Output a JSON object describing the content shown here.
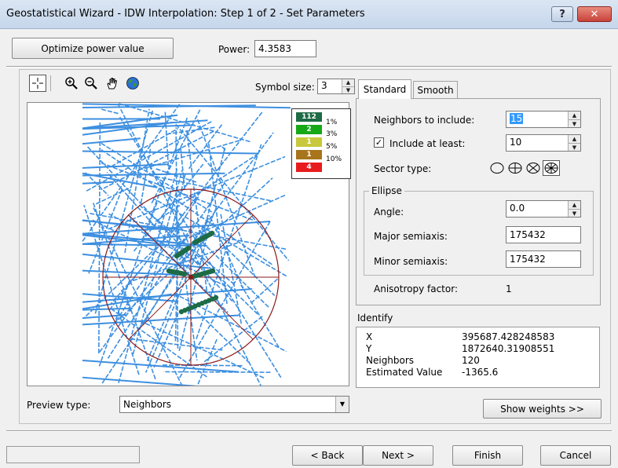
{
  "window": {
    "title": "Geostatistical Wizard - IDW Interpolation: Step 1 of 2 - Set Parameters",
    "help_label": "?",
    "close_label": "✕"
  },
  "top": {
    "optimize_label": "Optimize power value",
    "power_label": "Power:",
    "power_value": "4.3583"
  },
  "toolbar": {
    "symbol_size_label": "Symbol size:",
    "symbol_size_value": "3"
  },
  "tabs": [
    {
      "label": "Standard"
    },
    {
      "label": "Smooth"
    }
  ],
  "legend": {
    "rows": [
      {
        "count": "112",
        "color": "#1e6b46"
      },
      {
        "count": "2",
        "color": "#17a817"
      },
      {
        "count": "1",
        "color": "#c8c83c"
      },
      {
        "count": "1",
        "color": "#a8741c"
      },
      {
        "count": "4",
        "color": "#e81c1c"
      }
    ],
    "percents": [
      "1%",
      "3%",
      "5%",
      "10%"
    ]
  },
  "standard": {
    "neighbors_label": "Neighbors to include:",
    "neighbors_value": "15",
    "include_at_least_label": "Include at least:",
    "include_at_least_value": "10",
    "include_at_least_checked": "✓",
    "sector_type_label": "Sector type:",
    "ellipse_title": "Ellipse",
    "angle_label": "Angle:",
    "angle_value": "0.0",
    "major_label": "Major semiaxis:",
    "major_value": "175432",
    "minor_label": "Minor semiaxis:",
    "minor_value": "175432",
    "anisotropy_label": "Anisotropy factor:",
    "anisotropy_value": "1"
  },
  "identify": {
    "title": "Identify",
    "rows": [
      {
        "key": "X",
        "value": "395687.428248583"
      },
      {
        "key": "Y",
        "value": "1872640.31908551"
      },
      {
        "key": "Neighbors",
        "value": "120"
      },
      {
        "key": "Estimated Value",
        "value": "-1365.6"
      }
    ]
  },
  "preview": {
    "label": "Preview type:",
    "value": "Neighbors",
    "show_weights_label": "Show weights >>"
  },
  "footer": {
    "back_label": "< Back",
    "next_label": "Next >",
    "finish_label": "Finish",
    "cancel_label": "Cancel"
  },
  "colors": {
    "map_lines": "#3d8fe0",
    "neighbor_points": "#1e6b46",
    "ellipse": "#8b1a1a"
  }
}
